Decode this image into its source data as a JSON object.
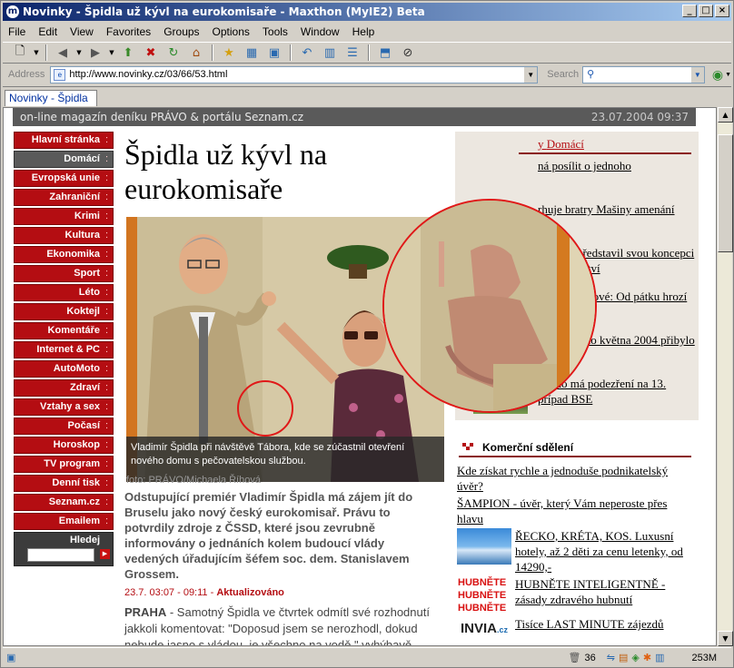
{
  "window": {
    "title": "Novinky - Špidla už kývl na eurokomisaře - Maxthon (MyIE2) Beta",
    "app_icon": "m"
  },
  "menu": [
    "File",
    "Edit",
    "View",
    "Favorites",
    "Groups",
    "Options",
    "Tools",
    "Window",
    "Help"
  ],
  "address": {
    "label": "Address",
    "url": "http://www.novinky.cz/03/66/53.html",
    "search_label": "Search"
  },
  "tab": {
    "label": "Novinky - Špidla už"
  },
  "page": {
    "header_left": "on-line magazín deníku PRÁVO & portálu Seznam.cz",
    "header_date": "23.07.2004 09:37",
    "nav": [
      "Hlavní stránka",
      "Domácí",
      "Evropská unie",
      "Zahraniční",
      "Krimi",
      "Kultura",
      "Ekonomika",
      "Sport",
      "Léto",
      "Koktejl",
      "Komentáře",
      "Internet & PC",
      "AutoMoto",
      "Zdraví",
      "Vztahy a sex",
      "Počasí",
      "Horoskop",
      "TV program",
      "Denní tisk",
      "Seznam.cz",
      "Emailem"
    ],
    "nav_active": "Domácí",
    "nav_search_label": "Hledej",
    "headline": "Špidla už kývl na eurokomisaře",
    "photo_caption": "Vladimír Špidla při návštěvě Tábora, kde se zúčastnil otevření nového domu s pečovatelskou službou.",
    "photo_credit": "foto: PRÁVO/Michaela Říhová",
    "perex": "Odstupující premiér Vladimír Špidla má zájem jít do Bruselu jako nový český eurokomisař. Právu to potvrdily zdroje z ČSSD, které jsou zevrubně informovány o jednáních kolem budoucí vlády vedených úřadujícím šéfem soc. dem. Stanislavem Grossem.",
    "dateline_time": "23.7. 03:07 - 09:11 - ",
    "dateline_updated": "Aktualizováno",
    "body_place": "PRAHA",
    "body_text": " - Samotný Špidla ve čtvrtek odmítl své rozhodnutí jakkoli komentovat: \"Doposud jsem se nerozhodl, dokud nebude jasno s vládou, je všechno na vodě,\" vyhýbavě sdělil"
  },
  "sidebar": {
    "section_prefix": "y ",
    "section_title": "Domácí",
    "items": [
      {
        "text": "ná posílit o jednoho"
      },
      {
        "text": "rhuje bratry Mašiny amenání"
      },
      {
        "text": "Alvinyi představil svou koncepci zdravotnictví"
      },
      {
        "text": "Meteorologové: Od pátku hrozí krupobití"
      },
      {
        "text": "V období do května 2004 přibylo Čechů"
      },
      {
        "text": "Česko má podezření na 13. případ BSE"
      }
    ],
    "commercial_title": "Komerční sdělení",
    "ads": [
      "Kde získat rychle a jednoduše podnikatelský úvěr?",
      "ŠAMPION - úvěr, který Vám neperoste přes hlavu",
      "ŘECKO, KRÉTA, KOS. Luxusní hotely, až 2 děti za cenu letenky, od 14290,-",
      "HUBNĚTE INTELIGENTNĚ - zásady zdravého hubnutí",
      "Tisíce LAST MINUTE zájezdů"
    ],
    "hubnete_logo": [
      "HUBNĚTE",
      "HUBNĚTE",
      "HUBNĚTE"
    ],
    "invia_logo": "INVIA",
    "invia_suffix": ".cz"
  },
  "status": {
    "count": "36",
    "memory": "253M"
  },
  "colors": {
    "accent": "#b40d12",
    "nav_active": "#5a5a5a",
    "title_gradient_start": "#0a246a"
  }
}
